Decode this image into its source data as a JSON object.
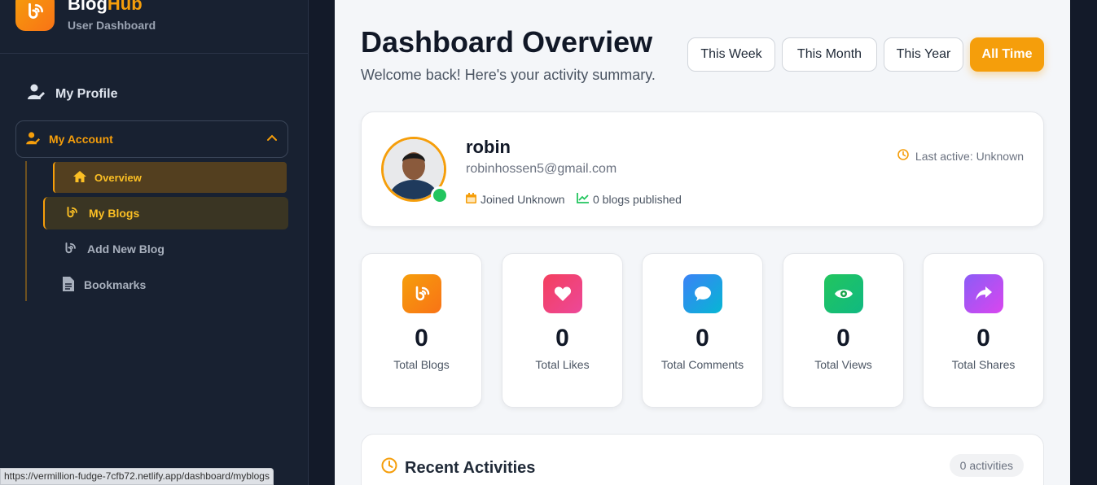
{
  "brand": {
    "name_main": "Blog",
    "name_accent": "Hub",
    "subtitle": "User Dashboard"
  },
  "sidebar": {
    "profile_label": "My Profile",
    "account_label": "My Account",
    "items": [
      {
        "label": "Overview"
      },
      {
        "label": "My Blogs"
      },
      {
        "label": "Add New Blog"
      },
      {
        "label": "Bookmarks"
      }
    ]
  },
  "status_url": "https://vermillion-fudge-7cfb72.netlify.app/dashboard/myblogs",
  "header": {
    "title": "Dashboard Overview",
    "subtitle": "Welcome back! Here's your activity summary.",
    "ranges": [
      {
        "label": "This Week"
      },
      {
        "label": "This Month"
      },
      {
        "label": "This Year"
      },
      {
        "label": "All Time"
      }
    ]
  },
  "profile": {
    "name": "robin",
    "email": "robinhossen5@gmail.com",
    "joined": "Joined Unknown",
    "blogs_published": "0 blogs published",
    "last_active": "Last active: Unknown"
  },
  "stats": [
    {
      "value": "0",
      "label": "Total Blogs",
      "icon": "blog-icon",
      "color": "#f97316"
    },
    {
      "value": "0",
      "label": "Total Likes",
      "icon": "heart-icon",
      "color": "#ec4899"
    },
    {
      "value": "0",
      "label": "Total Comments",
      "icon": "comment-icon",
      "color": "#3b82f6"
    },
    {
      "value": "0",
      "label": "Total Views",
      "icon": "eye-icon",
      "color": "#22c55e"
    },
    {
      "value": "0",
      "label": "Total Shares",
      "icon": "share-icon",
      "color": "#8b5cf6"
    }
  ],
  "activities": {
    "title": "Recent Activities",
    "count_label": "0 activities"
  },
  "colors": {
    "accent": "#f59e0b",
    "sidebar_bg": "#182131",
    "main_bg": "#f4f6f9"
  }
}
